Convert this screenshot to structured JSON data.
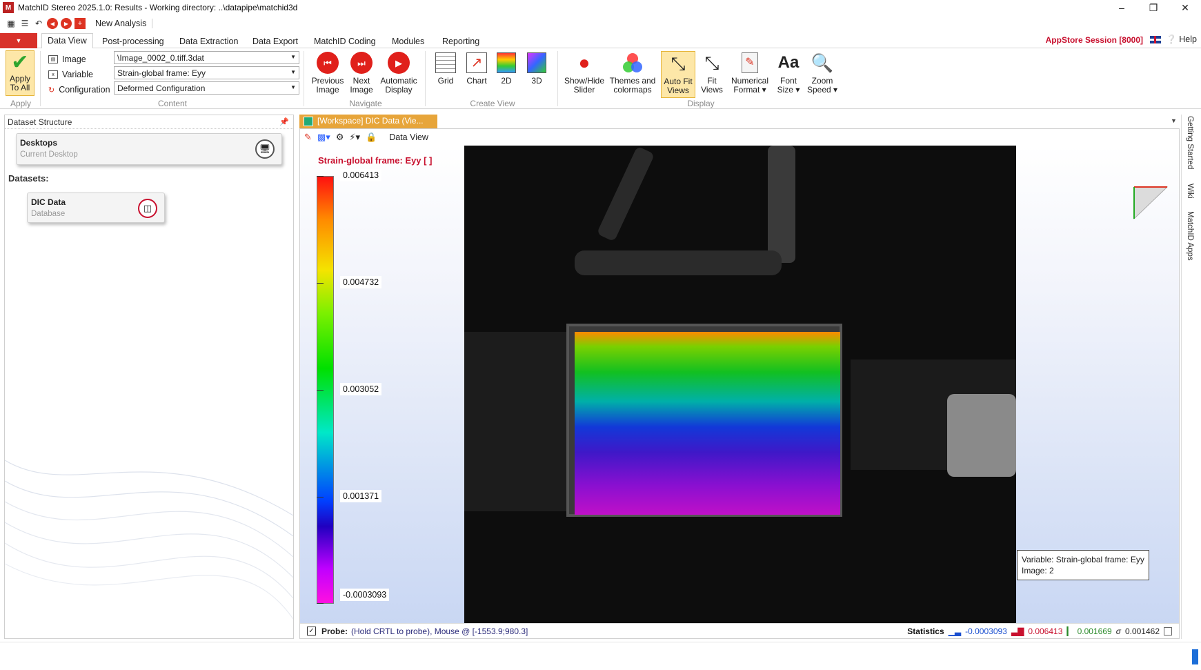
{
  "window": {
    "title": "MatchID Stereo 2025.1.0: Results - Working directory: ..\\datapipe\\matchid3d",
    "logo_text": "M"
  },
  "qat": {
    "label": "New Analysis"
  },
  "ribbon_tabs": [
    "Data View",
    "Post-processing",
    "Data Extraction",
    "Data Export",
    "MatchID Coding",
    "Modules",
    "Reporting"
  ],
  "session": {
    "label": "AppStore Session [8000]",
    "help": "Help"
  },
  "ribbon": {
    "apply": {
      "label_line1": "Apply",
      "label_line2": "To All",
      "group": "Apply"
    },
    "content": {
      "group": "Content",
      "image_label": "Image",
      "image_value": "\\Image_0002_0.tiff.3dat",
      "variable_label": "Variable",
      "variable_value": "Strain-global frame: Eyy",
      "config_label": "Configuration",
      "config_value": "Deformed Configuration"
    },
    "navigate": {
      "group": "Navigate",
      "prev": [
        "Previous",
        "Image"
      ],
      "next": [
        "Next",
        "Image"
      ],
      "auto": [
        "Automatic",
        "Display"
      ]
    },
    "create_view": {
      "group": "Create View",
      "grid": "Grid",
      "chart": "Chart",
      "twod": "2D",
      "threed": "3D"
    },
    "display": {
      "group": "Display",
      "slider": [
        "Show/Hide",
        "Slider"
      ],
      "themes": [
        "Themes and",
        "colormaps"
      ],
      "autofit": [
        "Auto Fit",
        "Views"
      ],
      "fit": [
        "Fit",
        "Views"
      ],
      "numfmt": [
        "Numerical",
        "Format ▾"
      ],
      "font": [
        "Font",
        "Size ▾"
      ],
      "zoom": [
        "Zoom",
        "Speed ▾"
      ]
    }
  },
  "left_panel": {
    "header": "Dataset Structure",
    "desktop_card": {
      "title": "Desktops",
      "subtitle": "Current Desktop"
    },
    "datasets_label": "Datasets:",
    "dic_card": {
      "title": "DIC Data",
      "subtitle": "Database"
    }
  },
  "doc_tab": {
    "title": "[Workspace] DIC Data (Vie..."
  },
  "view": {
    "toolbar_label": "Data View",
    "colorbar_title": "Strain-global frame: Eyy [ ]",
    "colorbar_ticks": [
      "0.006413",
      "0.004732",
      "0.003052",
      "0.001371",
      "-0.0003093"
    ],
    "info_variable": "Variable: Strain-global frame: Eyy",
    "info_image": "Image: 2"
  },
  "statusbar": {
    "probe_label": "Probe:",
    "probe_text": "(Hold CRTL to probe), Mouse @ [-1553.9;980.3]",
    "stats_label": "Statistics",
    "min": "-0.0003093",
    "max": "0.006413",
    "mean": "0.001669",
    "sigma_symbol": "σ",
    "std": "0.001462"
  },
  "side_tabs": [
    "Getting Started",
    "Wiki",
    "MatchID Apps"
  ],
  "colors": {
    "accent_red": "#c8102e",
    "tab_orange": "#e7a53a",
    "highlight": "#fde7a8"
  }
}
